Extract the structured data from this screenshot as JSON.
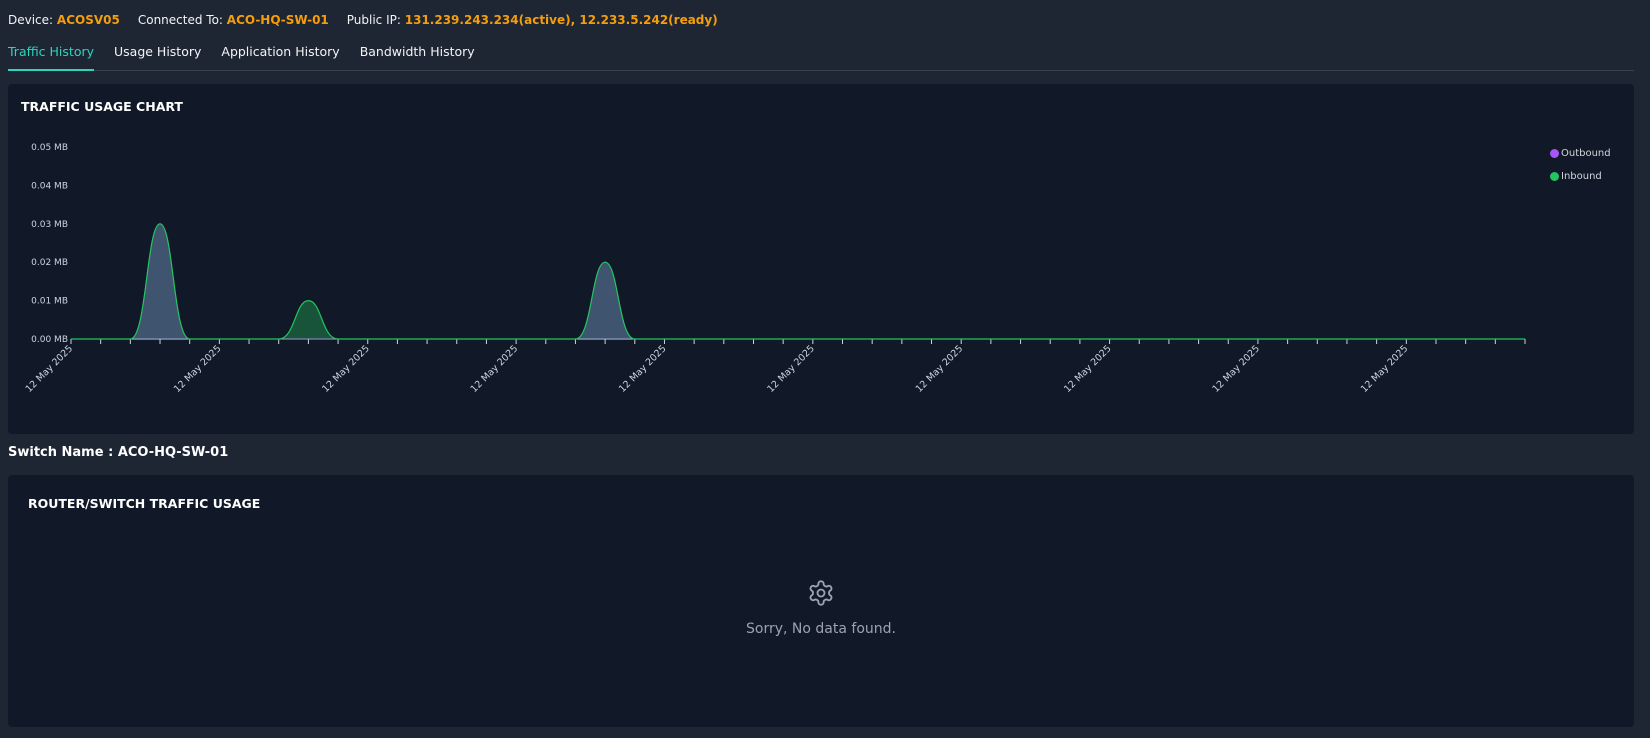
{
  "header": {
    "device_label": "Device:",
    "device_value": "ACOSV05",
    "connected_label": "Connected To:",
    "connected_value": "ACO-HQ-SW-01",
    "ip_label": "Public IP:",
    "ip_value": "131.239.243.234(active), 12.233.5.242(ready)"
  },
  "tabs": [
    {
      "label": "Traffic History",
      "active": true
    },
    {
      "label": "Usage History",
      "active": false
    },
    {
      "label": "Application History",
      "active": false
    },
    {
      "label": "Bandwidth History",
      "active": false
    }
  ],
  "traffic_panel": {
    "title": "TRAFFIC USAGE CHART"
  },
  "switch": {
    "label": "Switch Name :",
    "value": "ACO-HQ-SW-01"
  },
  "router_panel": {
    "title": "ROUTER/SWITCH TRAFFIC USAGE",
    "empty_text": "Sorry, No data found.",
    "empty_icon": "gear-icon"
  },
  "colors": {
    "accent": "#2dd4bf",
    "highlight": "#f59e0b",
    "outbound": "#a855f7",
    "inbound": "#22c55e"
  },
  "chart_data": {
    "type": "area",
    "title": "TRAFFIC USAGE CHART",
    "xlabel": "",
    "ylabel": "",
    "y_ticks": [
      "0.00 MB",
      "0.01 MB",
      "0.02 MB",
      "0.03 MB",
      "0.04 MB",
      "0.05 MB"
    ],
    "ylim": [
      0,
      0.05
    ],
    "x_tick_labels": [
      "12 May 2025",
      "12 May 2025",
      "12 May 2025",
      "12 May 2025",
      "12 May 2025",
      "12 May 2025",
      "12 May 2025",
      "12 May 2025",
      "12 May 2025",
      "12 May 2025"
    ],
    "x_range": [
      0,
      49
    ],
    "legend_position": "top-right",
    "grid": false,
    "series": [
      {
        "name": "Outbound",
        "color": "#a855f7",
        "points": [
          [
            3,
            0.03
          ],
          [
            18,
            0.02
          ]
        ]
      },
      {
        "name": "Inbound",
        "color": "#22c55e",
        "points": [
          [
            3,
            0.03
          ],
          [
            8,
            0.01
          ],
          [
            18,
            0.02
          ]
        ]
      }
    ]
  }
}
